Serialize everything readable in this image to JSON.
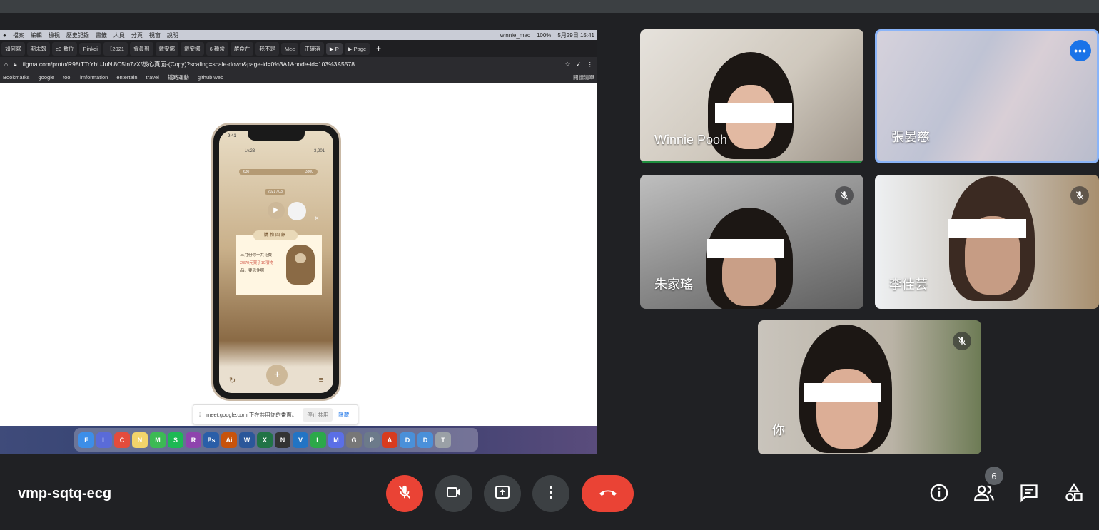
{
  "shared_screen": {
    "menubar": {
      "items": [
        "檔案",
        "編輯",
        "檢視",
        "歷史記錄",
        "書籤",
        "人員",
        "分頁",
        "視窗",
        "說明"
      ],
      "user": "winnie_mac",
      "battery": "100%",
      "datetime": "5月29日 15:41"
    },
    "tabs": [
      "如何寫",
      "期末報",
      "e3 數位",
      "Pinkoi",
      "【2021",
      "會員到",
      "戴安娜",
      "戴安娜",
      "6 種常",
      "嚴食在",
      "我不是",
      "Mee",
      "正確消",
      "▶ P",
      "▶ Page"
    ],
    "url": "figma.com/proto/R98tTTrYhUJuNl8C5In7zX/核心頁面-(Copy)?scaling=scale-down&page-id=0%3A1&node-id=103%3A5578",
    "bookmarks": [
      "Bookmarks",
      "google",
      "tool",
      "imformation",
      "entertain",
      "travel",
      "鐵路運動",
      "github web"
    ],
    "reading_list": "閱讀清單",
    "phone": {
      "time": "9:41",
      "level": "Lv.23",
      "coins": "3,201",
      "bar_left": "630",
      "bar_right": "3800",
      "date": "2021 / 03",
      "ribbon": "購物回顧",
      "text_line1": "三月份你一共花費",
      "text_amount": "2370元買了10項物",
      "text_line3": "品，要忍住啊！"
    },
    "share_banner": {
      "text": "meet.google.com 正在共用你的畫面。",
      "stop": "停止共用",
      "hide": "隱藏"
    },
    "dock_apps": [
      {
        "label": "F",
        "color": "#3d8ee8"
      },
      {
        "label": "L",
        "color": "#5a6bd8"
      },
      {
        "label": "C",
        "color": "#e34c3c"
      },
      {
        "label": "N",
        "color": "#f2d46b"
      },
      {
        "label": "M",
        "color": "#3cba54"
      },
      {
        "label": "S",
        "color": "#1db954"
      },
      {
        "label": "R",
        "color": "#8e44ad"
      },
      {
        "label": "Ps",
        "color": "#2a5ea8"
      },
      {
        "label": "Ai",
        "color": "#c8530c"
      },
      {
        "label": "W",
        "color": "#2b579a"
      },
      {
        "label": "X",
        "color": "#217346"
      },
      {
        "label": "N",
        "color": "#333333"
      },
      {
        "label": "V",
        "color": "#2274c4"
      },
      {
        "label": "L",
        "color": "#2ca84a"
      },
      {
        "label": "M",
        "color": "#5b6fe6"
      },
      {
        "label": "G",
        "color": "#777777"
      },
      {
        "label": "P",
        "color": "#6c7a8a"
      },
      {
        "label": "A",
        "color": "#d83b1e"
      },
      {
        "label": "D",
        "color": "#4a90d9"
      },
      {
        "label": "D",
        "color": "#4a90d9"
      },
      {
        "label": "T",
        "color": "#9aa0a6"
      }
    ]
  },
  "participants": [
    {
      "name": "Winnie Pooh"
    },
    {
      "name": "張晏慈"
    },
    {
      "name": "朱家瑤"
    },
    {
      "name": "李佳芸"
    },
    {
      "name": "你"
    }
  ],
  "bottom_bar": {
    "meeting_code": "vmp-sqtq-ecg",
    "participant_count": "6"
  },
  "colors": {
    "background": "#202124",
    "control_button": "#3c4043",
    "danger": "#ea4335",
    "accent": "#1a73e8",
    "active_speaker_border": "#8ab4f8"
  },
  "icons": [
    "mic-off-icon",
    "camera-icon",
    "present-icon",
    "more-vert-icon",
    "call-end-icon",
    "info-icon",
    "people-icon",
    "chat-icon",
    "activities-icon",
    "more-horiz-icon"
  ]
}
